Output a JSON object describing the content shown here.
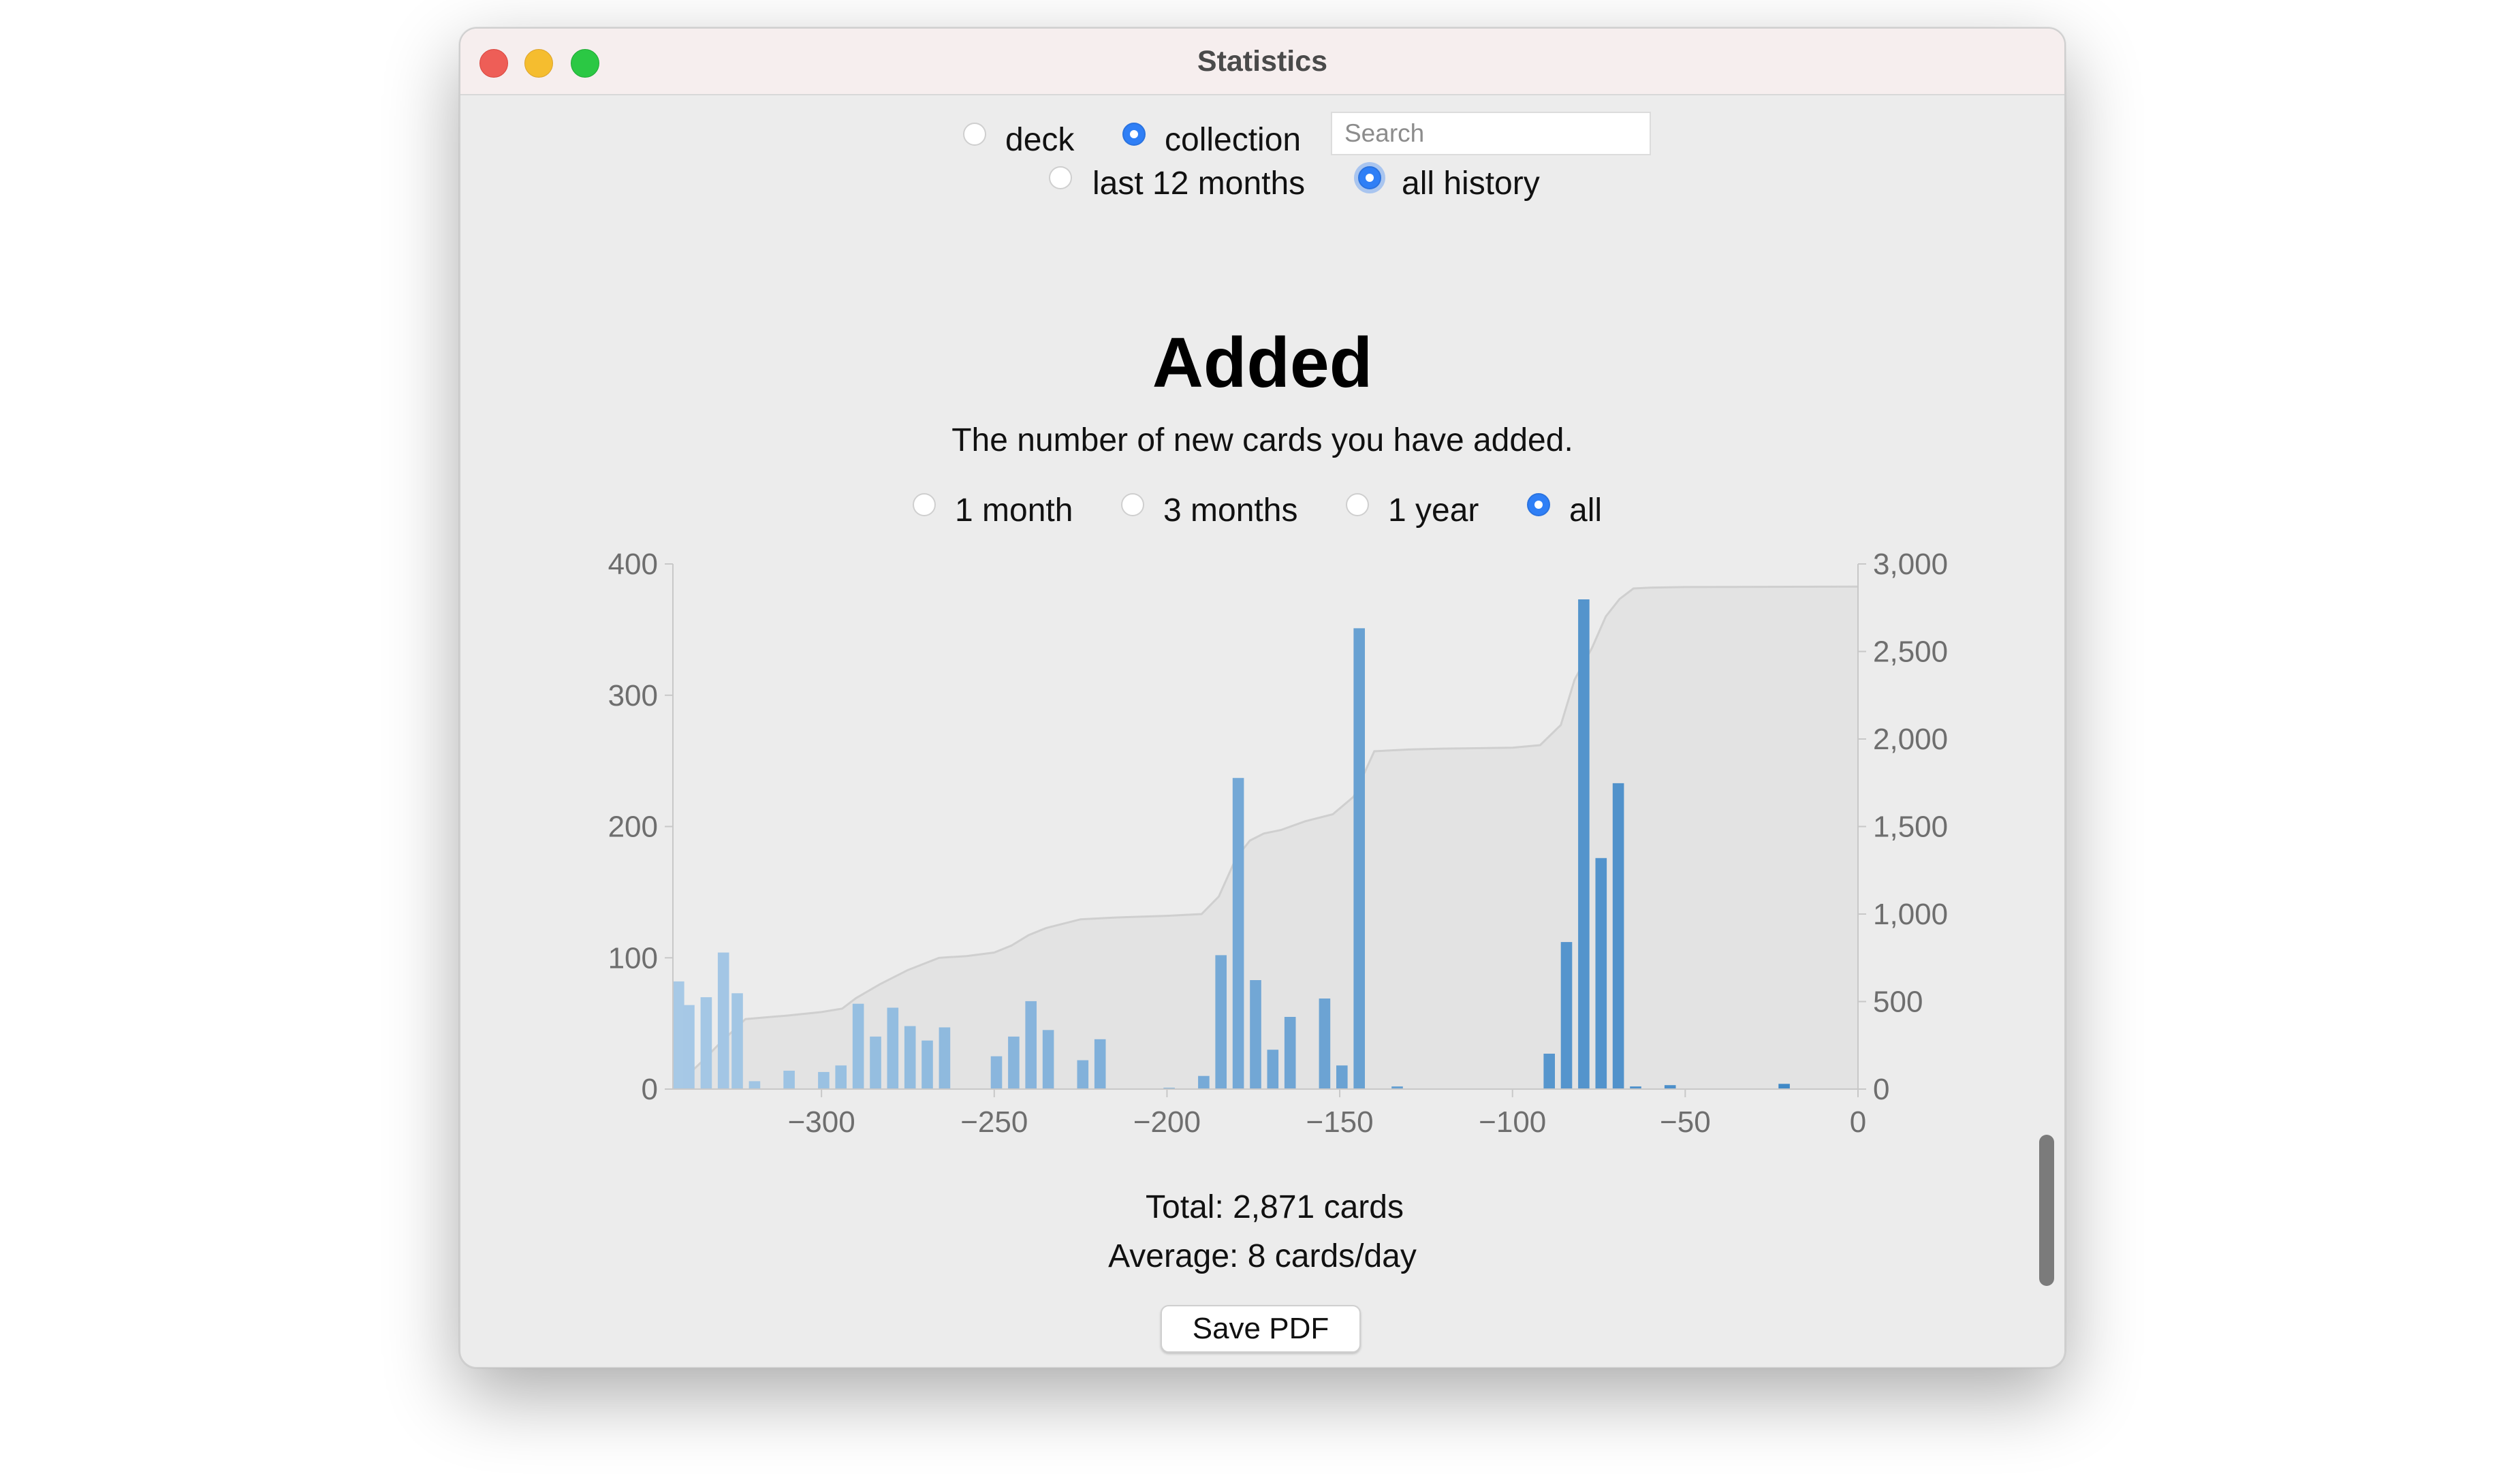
{
  "window": {
    "title": "Statistics"
  },
  "scope": {
    "deck_label": "deck",
    "collection_label": "collection",
    "selected": "collection",
    "search_placeholder": "Search",
    "last12_label": "last 12 months",
    "allhistory_label": "all history",
    "history_selected": "all history"
  },
  "section": {
    "title": "Added",
    "subtitle": "The number of new cards you have added."
  },
  "ranges": {
    "options": [
      "1 month",
      "3 months",
      "1 year",
      "all"
    ],
    "selected": "all"
  },
  "summary": {
    "total": "Total: 2,871 cards",
    "average": "Average: 8 cards/day"
  },
  "save_button_label": "Save PDF",
  "colors": {
    "accent": "#2f7ff6",
    "bar_light": "#a7c9e6",
    "bar_dark": "#3a84c4",
    "cumulative_fill": "#e3e3e3",
    "cumulative_line": "#cfcfcf"
  },
  "chart_data": {
    "type": "bar",
    "x_label": "",
    "y_left_label": "",
    "y_right_label": "",
    "xlim": [
      -343,
      0
    ],
    "ylim_left": [
      0,
      400
    ],
    "ylim_right": [
      0,
      3000
    ],
    "x_ticks": [
      -300,
      -250,
      -200,
      -150,
      -100,
      -50,
      0
    ],
    "x_tick_labels": [
      "−300",
      "−250",
      "−200",
      "−150",
      "−100",
      "−50",
      "0"
    ],
    "y_left_ticks": [
      0,
      100,
      200,
      300,
      400
    ],
    "y_left_tick_labels": [
      "0",
      "100",
      "200",
      "300",
      "400"
    ],
    "y_right_ticks": [
      0,
      500,
      1000,
      1500,
      2000,
      2500,
      3000
    ],
    "y_right_tick_labels": [
      "0",
      "500",
      "1,000",
      "1,500",
      "2,000",
      "2,500",
      "3,000"
    ],
    "bin_width_days": 4,
    "bars": [
      {
        "x": -343,
        "value": 82
      },
      {
        "x": -340,
        "value": 64
      },
      {
        "x": -335,
        "value": 70
      },
      {
        "x": -330,
        "value": 104
      },
      {
        "x": -326,
        "value": 73
      },
      {
        "x": -321,
        "value": 6
      },
      {
        "x": -311,
        "value": 14
      },
      {
        "x": -301,
        "value": 13
      },
      {
        "x": -296,
        "value": 18
      },
      {
        "x": -291,
        "value": 65
      },
      {
        "x": -286,
        "value": 40
      },
      {
        "x": -281,
        "value": 62
      },
      {
        "x": -276,
        "value": 48
      },
      {
        "x": -271,
        "value": 37
      },
      {
        "x": -266,
        "value": 47
      },
      {
        "x": -251,
        "value": 25
      },
      {
        "x": -246,
        "value": 40
      },
      {
        "x": -241,
        "value": 67
      },
      {
        "x": -236,
        "value": 45
      },
      {
        "x": -226,
        "value": 22
      },
      {
        "x": -221,
        "value": 38
      },
      {
        "x": -201,
        "value": 1
      },
      {
        "x": -191,
        "value": 10
      },
      {
        "x": -186,
        "value": 102
      },
      {
        "x": -181,
        "value": 237
      },
      {
        "x": -176,
        "value": 83
      },
      {
        "x": -171,
        "value": 30
      },
      {
        "x": -166,
        "value": 55
      },
      {
        "x": -156,
        "value": 69
      },
      {
        "x": -151,
        "value": 18
      },
      {
        "x": -146,
        "value": 351
      },
      {
        "x": -135,
        "value": 2
      },
      {
        "x": -91,
        "value": 27
      },
      {
        "x": -86,
        "value": 112
      },
      {
        "x": -81,
        "value": 373
      },
      {
        "x": -76,
        "value": 176
      },
      {
        "x": -71,
        "value": 233
      },
      {
        "x": -66,
        "value": 2
      },
      {
        "x": -56,
        "value": 3
      },
      {
        "x": -23,
        "value": 4
      }
    ],
    "cumulative": {
      "name": "",
      "x": [
        -343,
        -335,
        -330,
        -322,
        -310,
        -300,
        -294,
        -290,
        -283,
        -275,
        -266,
        -258,
        -250,
        -245,
        -240,
        -235,
        -225,
        -215,
        -200,
        -190,
        -185,
        -180,
        -176,
        -172,
        -167,
        -160,
        -152,
        -146,
        -140,
        -130,
        -120,
        -100,
        -92,
        -86,
        -82,
        -77,
        -73,
        -69,
        -65,
        -60,
        -50,
        0
      ],
      "values": [
        0,
        150,
        250,
        400,
        420,
        440,
        460,
        520,
        600,
        680,
        750,
        760,
        780,
        820,
        880,
        920,
        970,
        980,
        990,
        1000,
        1100,
        1320,
        1420,
        1460,
        1480,
        1530,
        1570,
        1670,
        1930,
        1940,
        1945,
        1950,
        1965,
        2080,
        2340,
        2520,
        2700,
        2800,
        2860,
        2865,
        2868,
        2871
      ]
    }
  }
}
